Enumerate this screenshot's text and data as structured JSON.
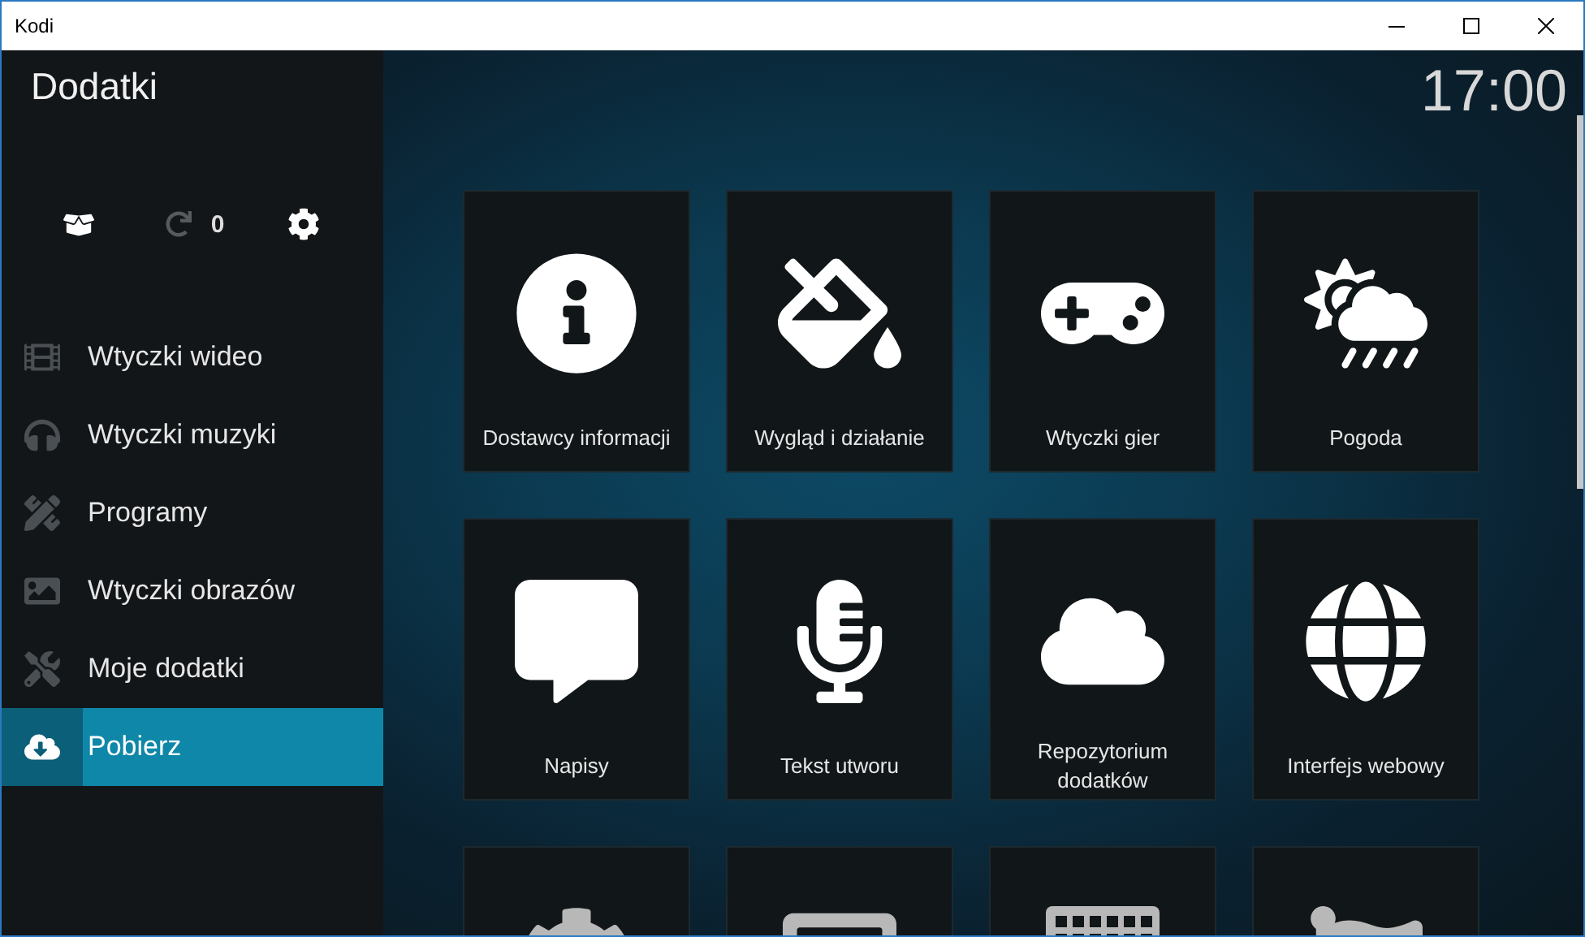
{
  "window": {
    "title": "Kodi"
  },
  "header": {
    "title": "Dodatki",
    "clock": "17:00"
  },
  "toolbar": {
    "update_count": "0"
  },
  "sidebar": {
    "items": [
      {
        "label": "Wtyczki wideo",
        "selected": false
      },
      {
        "label": "Wtyczki muzyki",
        "selected": false
      },
      {
        "label": "Programy",
        "selected": false
      },
      {
        "label": "Wtyczki obrazów",
        "selected": false
      },
      {
        "label": "Moje dodatki",
        "selected": false
      },
      {
        "label": "Pobierz",
        "selected": true
      }
    ]
  },
  "tiles": [
    {
      "label": "Dostawcy informacji"
    },
    {
      "label": "Wygląd i działanie"
    },
    {
      "label": "Wtyczki gier"
    },
    {
      "label": "Pogoda"
    },
    {
      "label": "Napisy"
    },
    {
      "label": "Tekst utworu"
    },
    {
      "label": "Repozytorium dodatków"
    },
    {
      "label": "Interfejs webowy"
    }
  ]
}
